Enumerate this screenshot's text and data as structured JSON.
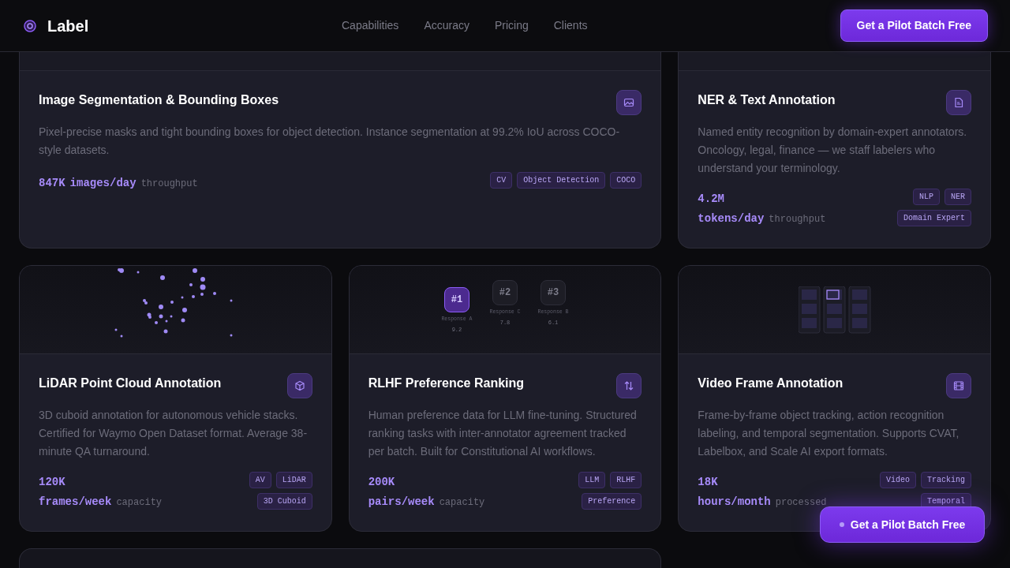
{
  "nav": {
    "brand": "Label",
    "links": [
      "Capabilities",
      "Accuracy",
      "Pricing",
      "Clients"
    ],
    "cta": "Get a Pilot Batch Free"
  },
  "cards": [
    {
      "kind": "segmentation",
      "wide": true,
      "title": "Image Segmentation & Bounding Boxes",
      "description": "Pixel-precise masks and tight bounding boxes for object detection. Instance segmentation at 99.2% IoU across COCO-style datasets.",
      "value": "847K",
      "unit": "images/day",
      "qualifier": "throughput",
      "tags": [
        "CV",
        "Object Detection",
        "COCO"
      ]
    },
    {
      "kind": "ner",
      "wide": false,
      "title": "NER & Text Annotation",
      "description": "Named entity recognition by domain-expert annotators. Oncology, legal, finance — we staff labelers who understand your terminology.",
      "value": "4.2M",
      "unit": "tokens/day",
      "qualifier": "throughput",
      "tags": [
        "NLP",
        "NER",
        "Domain Expert"
      ]
    },
    {
      "kind": "lidar",
      "wide": false,
      "title": "LiDAR Point Cloud Annotation",
      "description": "3D cuboid annotation for autonomous vehicle stacks. Certified for Waymo Open Dataset format. Average 38-minute QA turnaround.",
      "value": "120K",
      "unit": "frames/week",
      "qualifier": "capacity",
      "tags": [
        "AV",
        "LiDAR",
        "3D Cuboid"
      ]
    },
    {
      "kind": "rlhf",
      "wide": false,
      "title": "RLHF Preference Ranking",
      "description": "Human preference data for LLM fine-tuning. Structured ranking tasks with inter-annotator agreement tracked per batch. Built for Constitutional AI workflows.",
      "value": "200K",
      "unit": "pairs/week",
      "qualifier": "capacity",
      "tags": [
        "LLM",
        "RLHF",
        "Preference"
      ],
      "ranking": [
        {
          "rank": "#1",
          "label": "Response A",
          "score": "9.2",
          "selected": true
        },
        {
          "rank": "#2",
          "label": "Response C",
          "score": "7.8",
          "selected": false
        },
        {
          "rank": "#3",
          "label": "Response B",
          "score": "6.1",
          "selected": false
        }
      ]
    },
    {
      "kind": "video",
      "wide": false,
      "title": "Video Frame Annotation",
      "description": "Frame-by-frame object tracking, action recognition labeling, and temporal segmentation. Supports CVAT, Labelbox, and Scale AI export formats.",
      "value": "18K",
      "unit": "hours/month",
      "qualifier": "processed",
      "tags": [
        "Video",
        "Tracking",
        "Temporal"
      ]
    }
  ],
  "floating_cta": "Get a Pilot Batch Free"
}
